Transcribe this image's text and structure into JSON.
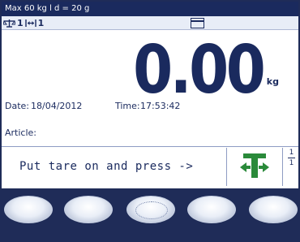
{
  "header": {
    "capacity_text": "Max 60 kg  l d = 20 g"
  },
  "status": {
    "scale_number": "1",
    "range_number": "1"
  },
  "display": {
    "weight": "0.00",
    "unit": "kg"
  },
  "info": {
    "date_label": "Date:",
    "date_value": "18/04/2012",
    "time_label": "Time:",
    "time_value": "17:53:42",
    "article_label": "Article:"
  },
  "prompt": {
    "text": "Put tare on and press ->",
    "tare_icon": "tare-icon",
    "page_current": "1",
    "page_total": "1"
  },
  "softkeys": [
    "softkey-1",
    "softkey-2",
    "softkey-3",
    "softkey-4",
    "softkey-5"
  ],
  "colors": {
    "navy": "#1a2a5e",
    "green": "#2a8a3a",
    "frame": "#1f2c58"
  }
}
